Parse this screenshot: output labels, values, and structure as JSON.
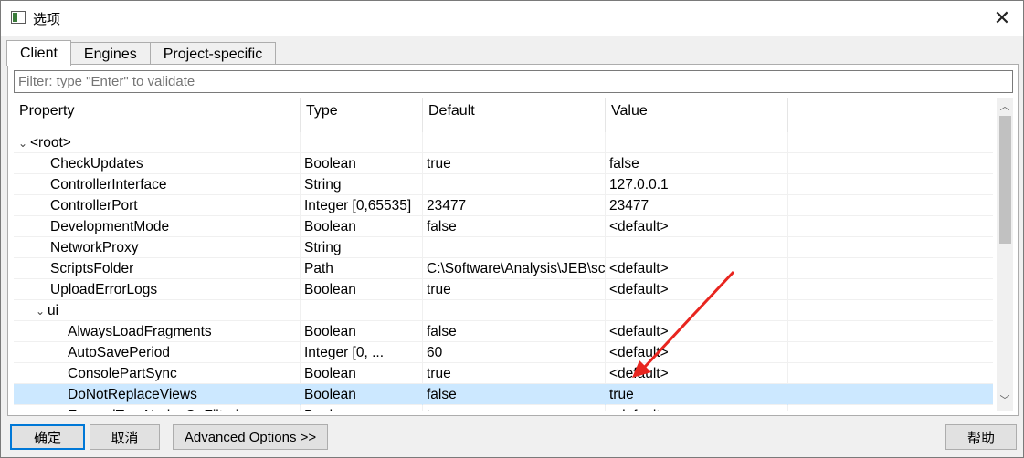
{
  "window": {
    "title": "选项",
    "close_glyph": "✕"
  },
  "tabs": [
    {
      "label": "Client",
      "active": true
    },
    {
      "label": "Engines",
      "active": false
    },
    {
      "label": "Project-specific",
      "active": false
    }
  ],
  "filter": {
    "placeholder": "Filter: type \"Enter\" to validate",
    "value": ""
  },
  "table": {
    "columns": [
      "Property",
      "Type",
      "Default",
      "Value"
    ],
    "rows": [
      {
        "property": "<root>",
        "type": "",
        "default": "",
        "value": "",
        "level": 0,
        "expandable": true
      },
      {
        "property": "CheckUpdates",
        "type": "Boolean",
        "default": "true",
        "value": "false",
        "level": 1
      },
      {
        "property": "ControllerInterface",
        "type": "String",
        "default": "",
        "value": "127.0.0.1",
        "level": 1
      },
      {
        "property": "ControllerPort",
        "type": "Integer [0,65535]",
        "default": "23477",
        "value": "23477",
        "level": 1
      },
      {
        "property": "DevelopmentMode",
        "type": "Boolean",
        "default": "false",
        "value": "<default>",
        "level": 1
      },
      {
        "property": "NetworkProxy",
        "type": "String",
        "default": "",
        "value": "",
        "level": 1
      },
      {
        "property": "ScriptsFolder",
        "type": "Path",
        "default": "C:\\Software\\Analysis\\JEB\\sc",
        "value": "<default>",
        "level": 1
      },
      {
        "property": "UploadErrorLogs",
        "type": "Boolean",
        "default": "true",
        "value": "<default>",
        "level": 1
      },
      {
        "property": "ui",
        "type": "",
        "default": "",
        "value": "",
        "level": 1,
        "expandable": true
      },
      {
        "property": "AlwaysLoadFragments",
        "type": "Boolean",
        "default": "false",
        "value": "<default>",
        "level": 2
      },
      {
        "property": "AutoSavePeriod",
        "type": "Integer [0, ...",
        "default": "60",
        "value": "<default>",
        "level": 2
      },
      {
        "property": "ConsolePartSync",
        "type": "Boolean",
        "default": "true",
        "value": "<default>",
        "level": 2
      },
      {
        "property": "DoNotReplaceViews",
        "type": "Boolean",
        "default": "false",
        "value": "true",
        "level": 2,
        "selected": true
      },
      {
        "property": "ExpandTreeNodesOnFiltering",
        "type": "Boolean",
        "default": "true",
        "value": "<default>",
        "level": 2
      }
    ]
  },
  "scrollbar": {
    "up_glyph": "︿",
    "down_glyph": "﹀"
  },
  "buttons": {
    "ok": "确定",
    "cancel": "取消",
    "advanced": "Advanced Options >>",
    "help": "帮助"
  },
  "colors": {
    "selection": "#cce8ff",
    "annotation_arrow": "#e8251f",
    "default_button_border": "#0078d7"
  },
  "icons": {
    "app": "window-icon",
    "close": "close-icon",
    "expand": "chevron-down-icon"
  }
}
